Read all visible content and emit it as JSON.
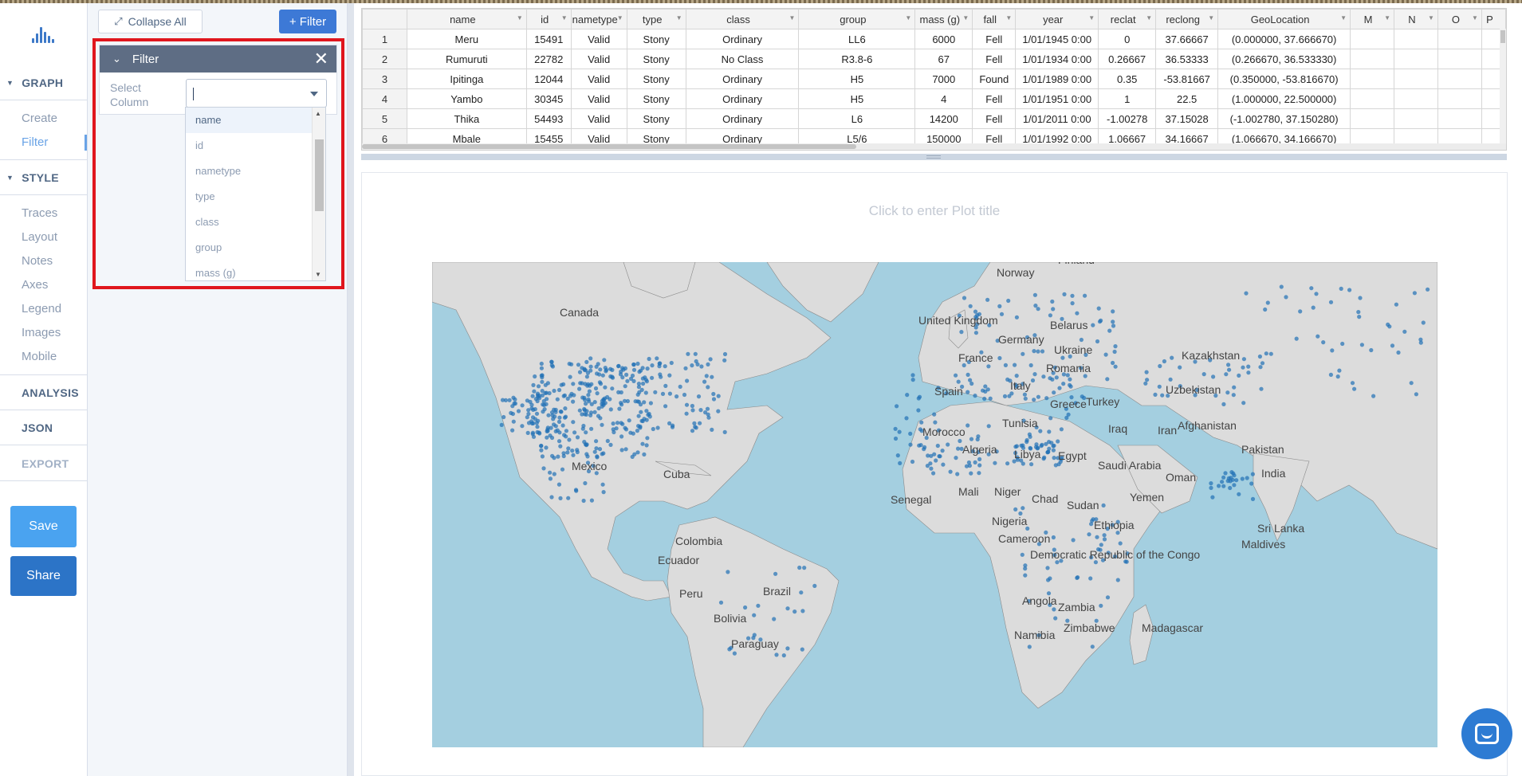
{
  "nav": {
    "sections": [
      {
        "key": "graph",
        "label": "GRAPH",
        "expanded": true,
        "items": [
          {
            "label": "Create",
            "active": false
          },
          {
            "label": "Filter",
            "active": true
          }
        ]
      },
      {
        "key": "style",
        "label": "STYLE",
        "expanded": true,
        "items": [
          {
            "label": "Traces"
          },
          {
            "label": "Layout"
          },
          {
            "label": "Notes"
          },
          {
            "label": "Axes"
          },
          {
            "label": "Legend"
          },
          {
            "label": "Images"
          },
          {
            "label": "Mobile"
          }
        ]
      },
      {
        "key": "analysis",
        "label": "ANALYSIS"
      },
      {
        "key": "json",
        "label": "JSON"
      },
      {
        "key": "export",
        "label": "EXPORT"
      }
    ],
    "save_label": "Save",
    "share_label": "Share"
  },
  "panel": {
    "collapse_all_label": "Collapse All",
    "add_filter_label": "+ Filter",
    "filter": {
      "title": "Filter",
      "select_label": "Select Column",
      "select_value": "",
      "options": [
        "name",
        "id",
        "nametype",
        "type",
        "class",
        "group",
        "mass (g)"
      ]
    }
  },
  "grid": {
    "columns": [
      "name",
      "id",
      "nametype",
      "type",
      "class",
      "group",
      "mass (g)",
      "fall",
      "year",
      "reclat",
      "reclong",
      "GeoLocation",
      "M",
      "N",
      "O",
      "P"
    ],
    "rows": [
      [
        "1",
        "Meru",
        "15491",
        "Valid",
        "Stony",
        "Ordinary",
        "LL6",
        "6000",
        "Fell",
        "1/01/1945 0:00",
        "0",
        "37.66667",
        "(0.000000, 37.666670)",
        "",
        "",
        "",
        ""
      ],
      [
        "2",
        "Rumuruti",
        "22782",
        "Valid",
        "Stony",
        "No Class",
        "R3.8-6",
        "67",
        "Fell",
        "1/01/1934 0:00",
        "0.26667",
        "36.53333",
        "(0.266670, 36.533330)",
        "",
        "",
        "",
        ""
      ],
      [
        "3",
        "Ipitinga",
        "12044",
        "Valid",
        "Stony",
        "Ordinary",
        "H5",
        "7000",
        "Found",
        "1/01/1989 0:00",
        "0.35",
        "-53.81667",
        "(0.350000, -53.816670)",
        "",
        "",
        "",
        ""
      ],
      [
        "4",
        "Yambo",
        "30345",
        "Valid",
        "Stony",
        "Ordinary",
        "H5",
        "4",
        "Fell",
        "1/01/1951 0:00",
        "1",
        "22.5",
        "(1.000000, 22.500000)",
        "",
        "",
        "",
        ""
      ],
      [
        "5",
        "Thika",
        "54493",
        "Valid",
        "Stony",
        "Ordinary",
        "L6",
        "14200",
        "Fell",
        "1/01/2011 0:00",
        "-1.00278",
        "37.15028",
        "(-1.002780, 37.150280)",
        "",
        "",
        "",
        ""
      ],
      [
        "6",
        "Mbale",
        "15455",
        "Valid",
        "Stony",
        "Ordinary",
        "L5/6",
        "150000",
        "Fell",
        "1/01/1992 0:00",
        "1.06667",
        "34.16667",
        "(1.066670, 34.166670)",
        "",
        "",
        "",
        ""
      ]
    ]
  },
  "plot": {
    "title_placeholder": "Click to enter Plot title",
    "marker_color": "#2171b5",
    "land_color": "#dcdcdc",
    "water_color": "#a4cfe0",
    "map_labels": [
      "Canada",
      "Norway",
      "Finland",
      "United Kingdom",
      "Belarus",
      "Germany",
      "France",
      "Ukraine",
      "Kazakhstan",
      "Romania",
      "Spain",
      "Italy",
      "Uzbekistan",
      "Turkey",
      "Greece",
      "Afghanistan",
      "Iraq",
      "Iran",
      "Tunisia",
      "Morocco",
      "Algeria",
      "Libya",
      "Egypt",
      "Pakistan",
      "Saudi Arabia",
      "India",
      "Oman",
      "Mali",
      "Niger",
      "Chad",
      "Sudan",
      "Yemen",
      "Senegal",
      "Nigeria",
      "Ethiopia",
      "Cameroon",
      "Democratic Republic of the Congo",
      "Sri Lanka",
      "Maldives",
      "Angola",
      "Zambia",
      "Madagascar",
      "Namibia",
      "Zimbabwe",
      "Mexico",
      "Cuba",
      "Colombia",
      "Ecuador",
      "Peru",
      "Brazil",
      "Bolivia",
      "Paraguay"
    ]
  }
}
